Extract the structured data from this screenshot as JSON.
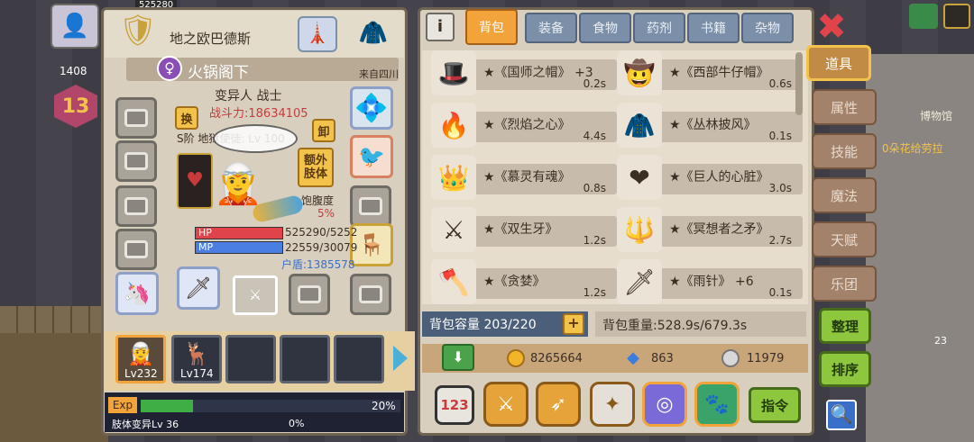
{
  "hero": {
    "top_stat": "525280",
    "gold_small": "1408",
    "level_badge": "13",
    "title": "地之欧巴德斯",
    "name": "火锅阁下",
    "origin": "来自四川",
    "class": "变异人 战士",
    "power": "战斗力:18634105",
    "rank_line": "S阶 地狱使徒: Lv 100",
    "swap_btn": "换",
    "unequip_btn": "卸",
    "extra_btn_line1": "额外",
    "extra_btn_line2": "肢体",
    "satiety_label": "饱腹度",
    "satiety_value": "5%",
    "hp_label": "HP",
    "hp_value": "525290/5252",
    "mp_label": "MP",
    "mp_value": "22559/30079",
    "shield_value": "户盾:1385578"
  },
  "party": [
    {
      "level": "Lv232"
    },
    {
      "level": "Lv174"
    }
  ],
  "exp": {
    "label": "Exp",
    "percent": "20%",
    "fill": 0.2,
    "sub_label": "肢体变异Lv 36",
    "sub_percent": "0%"
  },
  "tabs": [
    {
      "label": "背包"
    },
    {
      "label": "装备"
    },
    {
      "label": "食物"
    },
    {
      "label": "药剂"
    },
    {
      "label": "书籍"
    },
    {
      "label": "杂物"
    }
  ],
  "items": [
    {
      "name": "★《国师之帽》 +3",
      "weight": "0.2s",
      "icon": "🎩"
    },
    {
      "name": "★《西部牛仔帽》",
      "weight": "0.6s",
      "icon": "🤠"
    },
    {
      "name": "★《烈焰之心》",
      "weight": "4.4s",
      "icon": "🔥"
    },
    {
      "name": "★《丛林披风》",
      "weight": "0.1s",
      "icon": "🧥"
    },
    {
      "name": "★《慕灵有魂》",
      "weight": "0.8s",
      "icon": "👑"
    },
    {
      "name": "★《巨人的心脏》",
      "weight": "3.0s",
      "icon": "❤"
    },
    {
      "name": "★《双生牙》",
      "weight": "1.2s",
      "icon": "⚔"
    },
    {
      "name": "★《冥想者之矛》",
      "weight": "2.7s",
      "icon": "🔱"
    },
    {
      "name": "★《贪婪》",
      "weight": "1.2s",
      "icon": "🪓"
    },
    {
      "name": "★《雨针》 +6",
      "weight": "0.1s",
      "icon": "🗡"
    }
  ],
  "bag": {
    "capacity": "背包容量 203/220",
    "weight": "背包重量:528.9s/679.3s"
  },
  "currency": {
    "gold": "8265664",
    "gem": "863",
    "silver": "11979"
  },
  "command_btn": "指令",
  "side_tabs": [
    {
      "label": "道具"
    },
    {
      "label": "属性"
    },
    {
      "label": "技能"
    },
    {
      "label": "魔法"
    },
    {
      "label": "天赋"
    },
    {
      "label": "乐团"
    }
  ],
  "organize_btn": "整理",
  "sort_btn": "排序",
  "world": {
    "museum": "博物馆",
    "quest": "0朵花给劳拉",
    "corner_num": "23"
  },
  "colors": {
    "accent": "#f2a33a",
    "hp": "#e0434a",
    "mp": "#4a7ee0",
    "exp": "#3fae45"
  }
}
